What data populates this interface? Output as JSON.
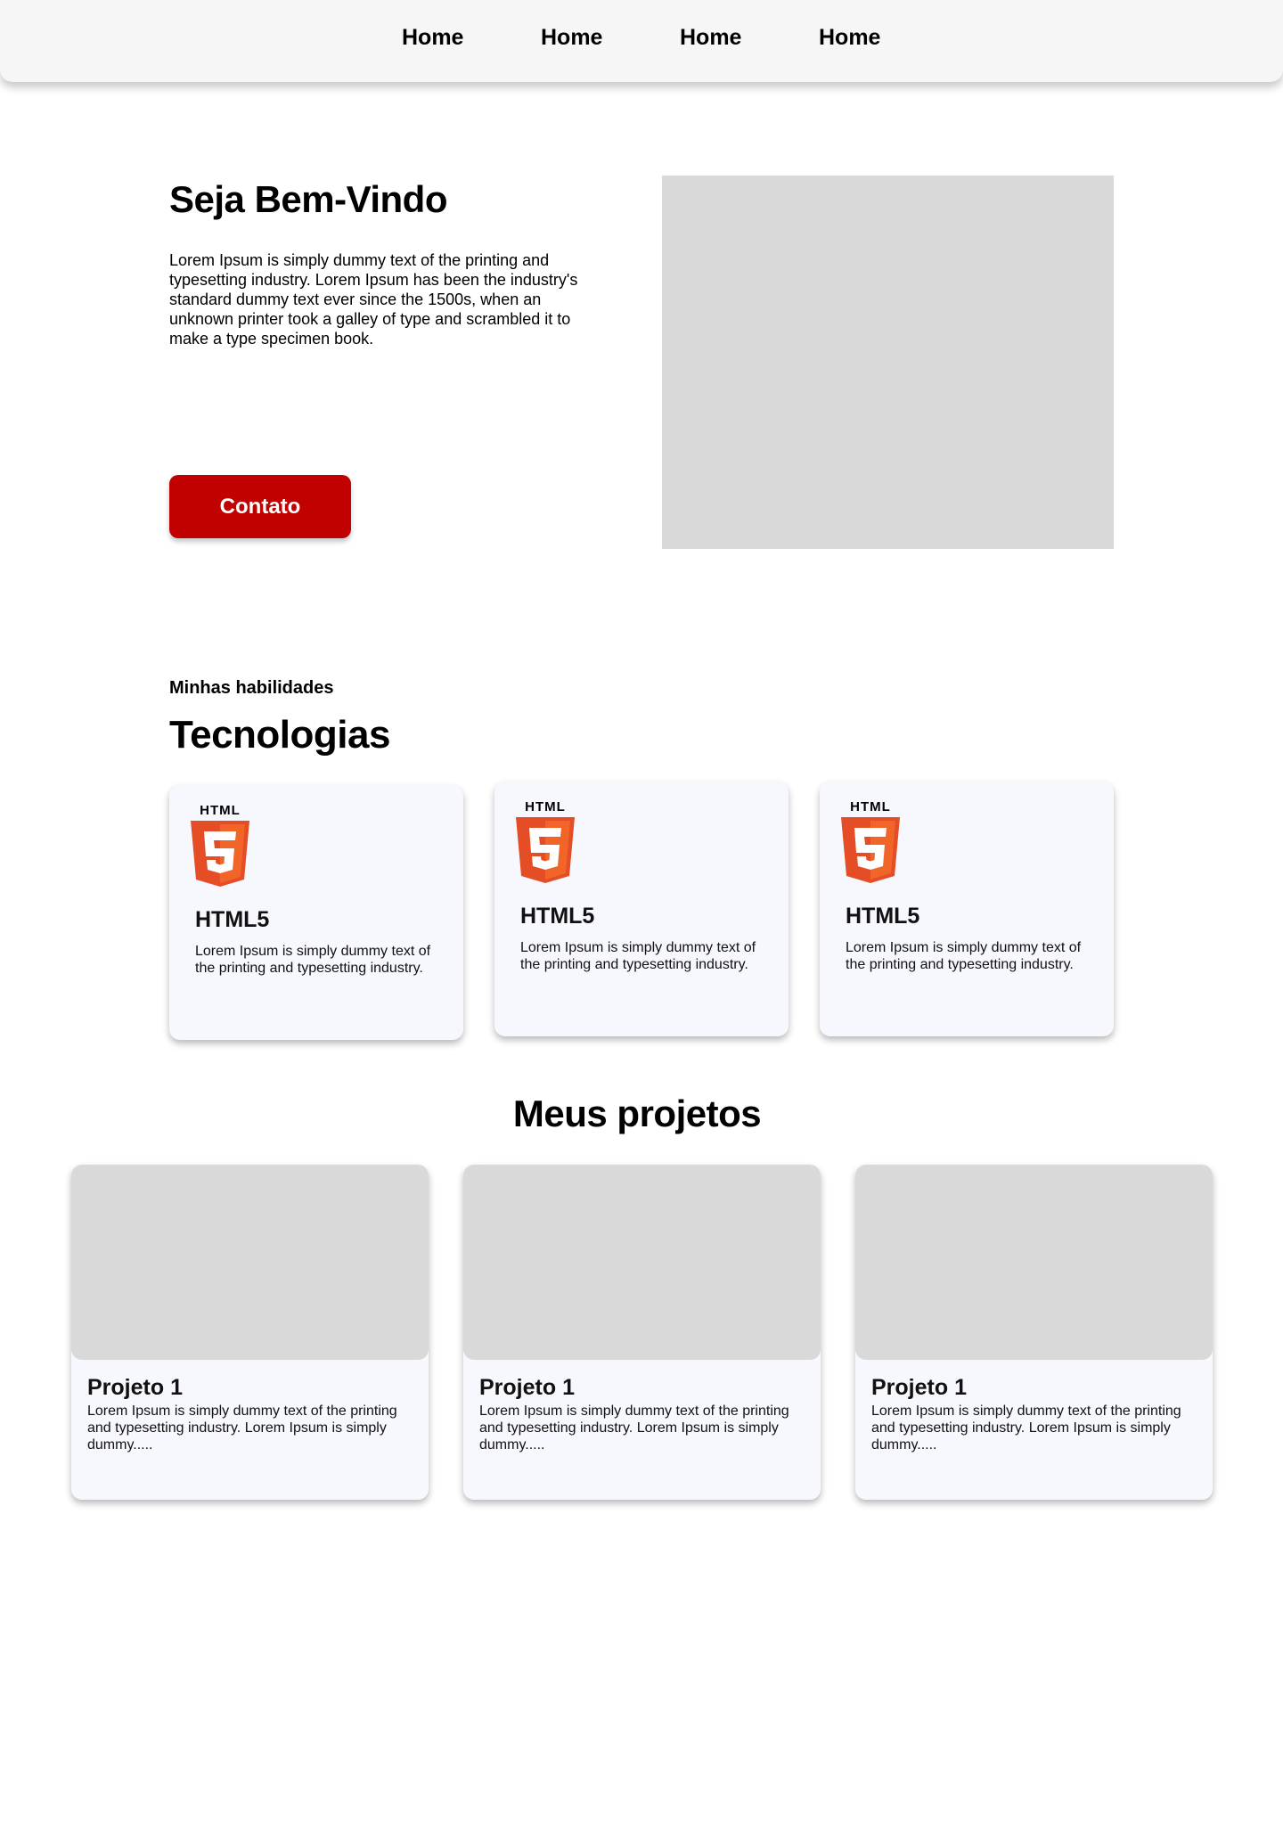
{
  "nav": {
    "items": [
      {
        "label": "Home"
      },
      {
        "label": "Home"
      },
      {
        "label": "Home"
      },
      {
        "label": "Home"
      }
    ]
  },
  "hero": {
    "title": "Seja Bem-Vindo",
    "text": "Lorem Ipsum is simply dummy text of the printing and typesetting industry. Lorem Ipsum has been the industry's standard dummy text ever since the 1500s, when an unknown printer took a galley of type and scrambled it to make a type specimen book.",
    "button_label": "Contato"
  },
  "skills": {
    "eyebrow": "Minhas habilidades",
    "title": "Tecnologias",
    "cards": [
      {
        "logo_text": "HTML",
        "icon": "html5-icon",
        "name": "HTML5",
        "desc": "Lorem Ipsum is simply dummy text of the printing and typesetting industry."
      },
      {
        "logo_text": "HTML",
        "icon": "html5-icon",
        "name": "HTML5",
        "desc": "Lorem Ipsum is simply dummy text of the printing and typesetting industry."
      },
      {
        "logo_text": "HTML",
        "icon": "html5-icon",
        "name": "HTML5",
        "desc": "Lorem Ipsum is simply dummy text of the printing and typesetting industry."
      }
    ]
  },
  "projects": {
    "title": "Meus projetos",
    "cards": [
      {
        "title": "Projeto 1",
        "desc": "Lorem Ipsum is simply dummy text of the printing and typesetting industry. Lorem Ipsum is simply dummy....."
      },
      {
        "title": "Projeto 1",
        "desc": "Lorem Ipsum is simply dummy text of the printing and typesetting industry. Lorem Ipsum is simply dummy....."
      },
      {
        "title": "Projeto 1",
        "desc": "Lorem Ipsum is simply dummy text of the printing and typesetting industry. Lorem Ipsum is simply dummy....."
      }
    ]
  },
  "colors": {
    "accent": "#c10000",
    "nav_background": "#f6f6f6",
    "placeholder": "#d9d9d9",
    "card_background": "#f7f7fe",
    "html5_orange": "#e44d26",
    "html5_light": "#f16529"
  }
}
